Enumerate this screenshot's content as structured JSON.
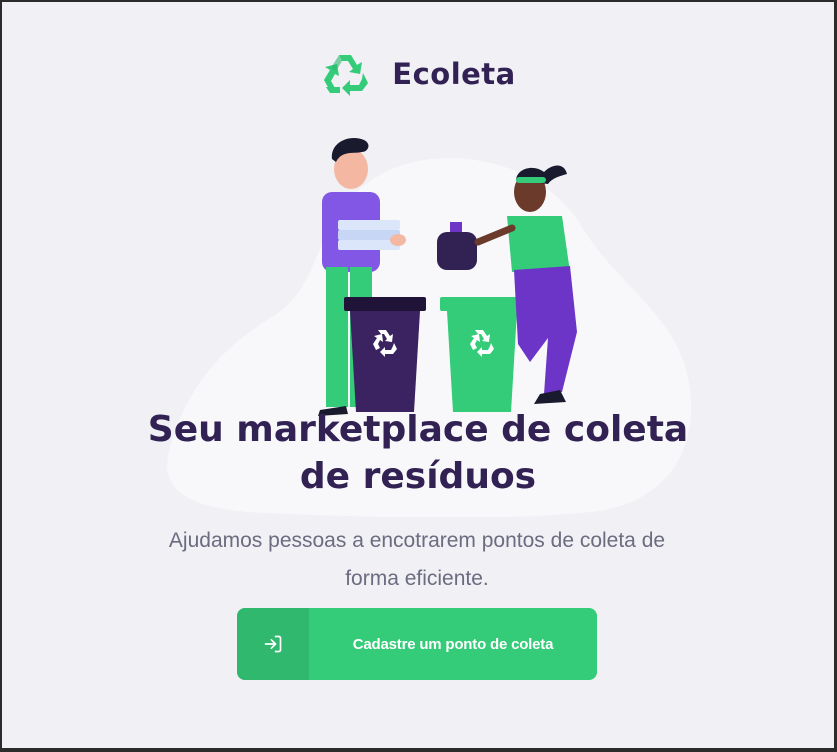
{
  "brand": {
    "name": "Ecoleta",
    "icon": "recycle-icon",
    "primary_color": "#34cb79",
    "title_color": "#322153",
    "text_color": "#6c6c80",
    "background_color": "#f0f0f5"
  },
  "hero": {
    "title_line1": "Seu marketplace de coleta",
    "title_line2": "de resíduos",
    "subtitle_line1": "Ajudamos pessoas a encotrarem pontos de coleta de",
    "subtitle_line2": "forma eficiente."
  },
  "cta": {
    "label": "Cadastre um ponto de coleta",
    "icon": "log-in-icon"
  }
}
